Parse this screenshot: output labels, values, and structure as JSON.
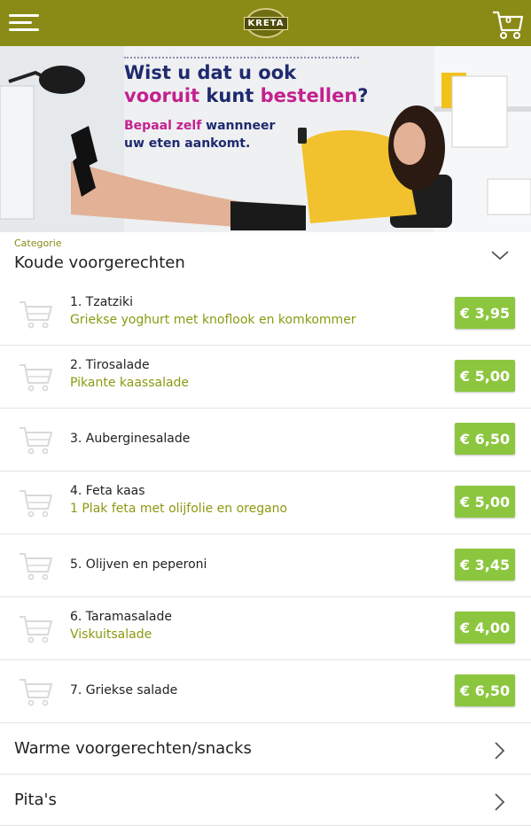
{
  "header": {
    "menu_icon": "hamburger-menu-icon",
    "logo_text": "KRETA",
    "cart_icon": "shopping-cart-icon",
    "cart_count": "0",
    "bar_color": "#8a8a16"
  },
  "banner": {
    "line1": "Wist u dat u ook",
    "line2_a": "vooruit",
    "line2_b": " kunt ",
    "line2_c": "bestellen",
    "line2_d": "?",
    "line3_a": "Bepaal zelf",
    "line3_b": " wannneer",
    "line4": "uw eten aankomt."
  },
  "category": {
    "label": "Categorie",
    "title": "Koude voorgerechten"
  },
  "items": [
    {
      "name": "1. Tzatziki",
      "desc": "Griekse yoghurt met knoflook en komkommer",
      "price": "€ 3,95"
    },
    {
      "name": "2. Tirosalade",
      "desc": "Pikante kaassalade",
      "price": "€ 5,00"
    },
    {
      "name": "3. Auberginesalade",
      "desc": "",
      "price": "€ 6,50"
    },
    {
      "name": "4. Feta kaas",
      "desc": "1 Plak feta met olijfolie en oregano",
      "price": "€ 5,00"
    },
    {
      "name": "5. Olijven en peperoni",
      "desc": "",
      "price": "€ 3,45"
    },
    {
      "name": "6. Taramasalade",
      "desc": "Viskuitsalade",
      "price": "€ 4,00"
    },
    {
      "name": "7. Griekse salade",
      "desc": "",
      "price": "€ 6,50"
    }
  ],
  "sections": [
    {
      "label": "Warme voorgerechten/snacks"
    },
    {
      "label": "Pita's"
    }
  ],
  "colors": {
    "accent_green": "#8cc63f",
    "olive": "#8a8a16",
    "desc_green": "#8a9a10"
  }
}
